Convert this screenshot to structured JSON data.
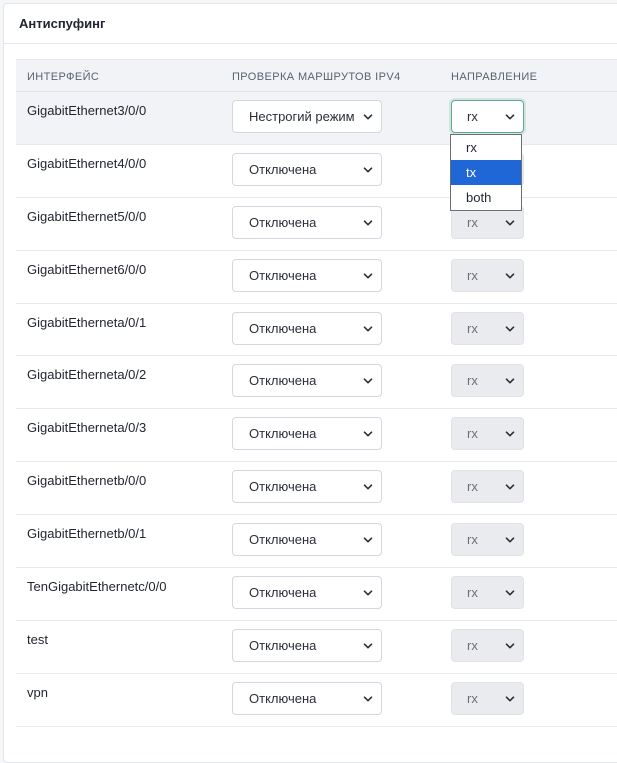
{
  "card": {
    "title": "Антиспуфинг"
  },
  "table": {
    "headers": {
      "interface": "ИНТЕРФЕЙС",
      "route_check": "ПРОВЕРКА МАРШРУТОВ IPV4",
      "direction": "НАПРАВЛЕНИЕ"
    },
    "rows": [
      {
        "interface": "GigabitEthernet3/0/0",
        "mode": "Нестрогий режим",
        "direction": "rx",
        "direction_state": "open"
      },
      {
        "interface": "GigabitEthernet4/0/0",
        "mode": "Отключена",
        "direction": "rx",
        "direction_state": "disabled"
      },
      {
        "interface": "GigabitEthernet5/0/0",
        "mode": "Отключена",
        "direction": "rx",
        "direction_state": "disabled"
      },
      {
        "interface": "GigabitEthernet6/0/0",
        "mode": "Отключена",
        "direction": "rx",
        "direction_state": "disabled"
      },
      {
        "interface": "GigabitEtherneta/0/1",
        "mode": "Отключена",
        "direction": "rx",
        "direction_state": "disabled"
      },
      {
        "interface": "GigabitEtherneta/0/2",
        "mode": "Отключена",
        "direction": "rx",
        "direction_state": "disabled"
      },
      {
        "interface": "GigabitEtherneta/0/3",
        "mode": "Отключена",
        "direction": "rx",
        "direction_state": "disabled"
      },
      {
        "interface": "GigabitEthernetb/0/0",
        "mode": "Отключена",
        "direction": "rx",
        "direction_state": "disabled"
      },
      {
        "interface": "GigabitEthernetb/0/1",
        "mode": "Отключена",
        "direction": "rx",
        "direction_state": "disabled"
      },
      {
        "interface": "TenGigabitEthernetc/0/0",
        "mode": "Отключена",
        "direction": "rx",
        "direction_state": "disabled"
      },
      {
        "interface": "test",
        "mode": "Отключена",
        "direction": "rx",
        "direction_state": "disabled"
      },
      {
        "interface": "vpn",
        "mode": "Отключена",
        "direction": "rx",
        "direction_state": "disabled"
      }
    ]
  },
  "direction_dropdown": {
    "options": [
      "rx",
      "tx",
      "both"
    ],
    "highlighted": "tx"
  },
  "colors": {
    "accent_highlight": "#1f66d6",
    "focus_border": "#62a890"
  },
  "icons": {
    "select_arrow": "chevron-down-icon"
  }
}
